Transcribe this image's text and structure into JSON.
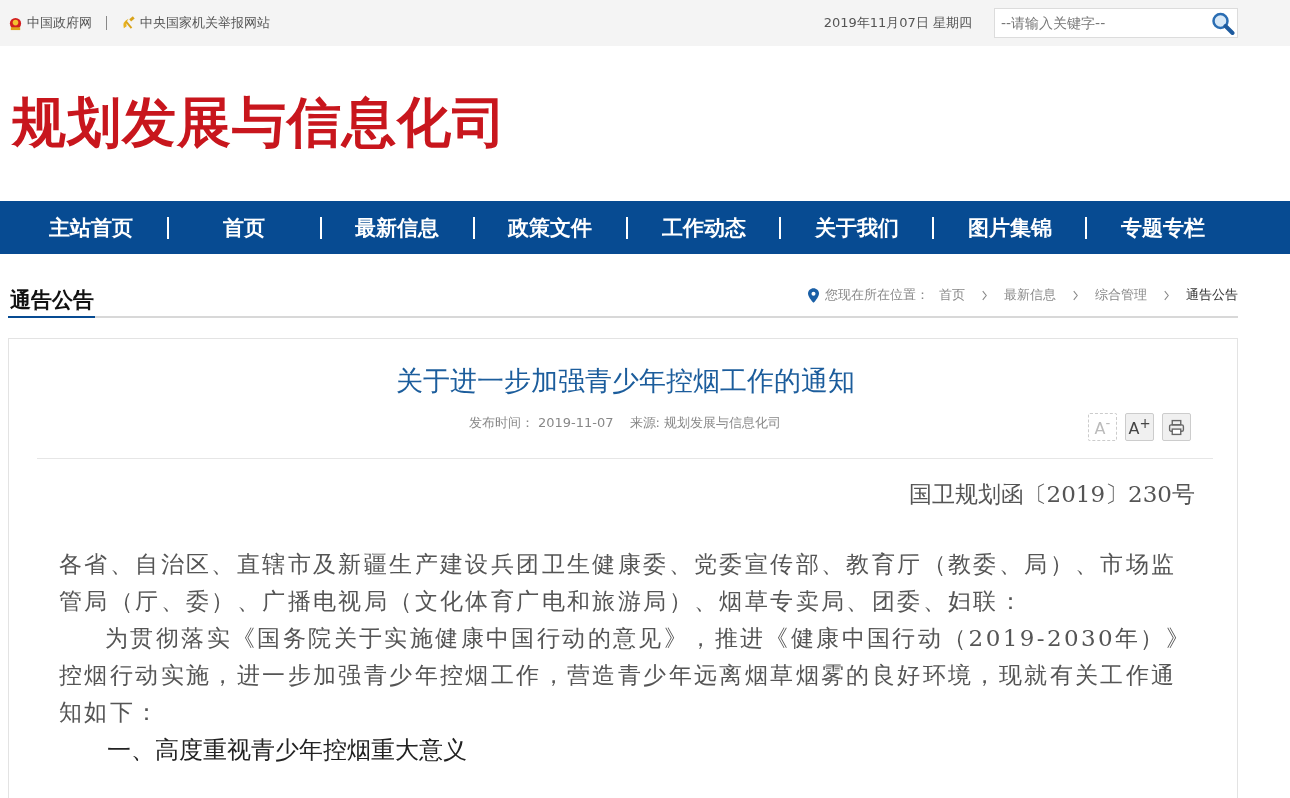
{
  "top_bar": {
    "links": [
      {
        "label": "中国政府网",
        "kind": "government"
      },
      {
        "label": "中央国家机关举报网站",
        "kind": "report"
      }
    ],
    "date": "2019年11月07日 星期四",
    "search": {
      "placeholder": "--请输入关键字--"
    }
  },
  "header": {
    "title": "规划发展与信息化司"
  },
  "nav": [
    {
      "label": "主站首页"
    },
    {
      "label": "首页"
    },
    {
      "label": "最新信息"
    },
    {
      "label": "政策文件"
    },
    {
      "label": "工作动态"
    },
    {
      "label": "关于我们"
    },
    {
      "label": "图片集锦"
    },
    {
      "label": "专题专栏"
    }
  ],
  "section": {
    "title": "通告公告",
    "breadcrumb_label": "您现在所在位置：",
    "breadcrumb": [
      {
        "label": "首页",
        "current": false
      },
      {
        "label": "最新信息",
        "current": false
      },
      {
        "label": "综合管理",
        "current": false
      },
      {
        "label": "通告公告",
        "current": true
      }
    ]
  },
  "article": {
    "title": "关于进一步加强青少年控烟工作的通知",
    "meta": [
      {
        "label": "发布时间：",
        "value": "2019-11-07"
      },
      {
        "label": "来源:",
        "value": "规划发展与信息化司"
      }
    ],
    "tools": [
      {
        "kind": "font",
        "label": "A$^{-}$",
        "disabled": true
      },
      {
        "kind": "font",
        "label": "A$^{+}$",
        "disabled": false
      },
      {
        "kind": "print",
        "disabled": false
      }
    ],
    "doc_number": "国卫规划函〔2019〕230号",
    "body": [
      {
        "kind": "paragraph",
        "text": "各省、自治区、直辖市及新疆生产建设兵团卫生健康委、党委宣传部、教育厅（教委、局）、市场监管局（厅、委）、广播电视局（文化体育广电和旅游局）、烟草专卖局、团委、妇联："
      },
      {
        "kind": "indented",
        "text": "为贯彻落实《国务院关于实施健康中国行动的意见》，推进《健康中国行动（2019-2030年）》控烟行动实施，进一步加强青少年控烟工作，营造青少年远离烟草烟雾的良好环境，现就有关工作通知如下："
      },
      {
        "kind": "heading",
        "text": "一、高度重视青少年控烟重大意义"
      }
    ]
  }
}
